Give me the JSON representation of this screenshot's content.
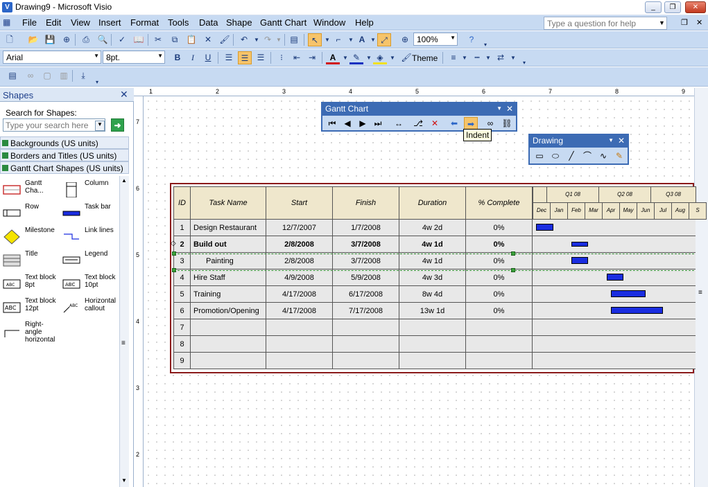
{
  "window": {
    "title": "Drawing9 - Microsoft Visio",
    "app_icon": "visio-icon",
    "min_label": "_",
    "max_label": "❐",
    "close_label": "✕"
  },
  "menu": {
    "items": [
      "File",
      "Edit",
      "View",
      "Insert",
      "Format",
      "Tools",
      "Data",
      "Shape",
      "Gantt Chart",
      "Window",
      "Help"
    ],
    "help_placeholder": "Type a question for help"
  },
  "standard_toolbar": {
    "zoom": "100%"
  },
  "format_toolbar": {
    "font": "Arial",
    "size": "8pt.",
    "bold": "B",
    "italic": "I",
    "underline": "U",
    "theme_label": "Theme"
  },
  "shapes_panel": {
    "title": "Shapes",
    "close": "✕",
    "search_label": "Search for Shapes:",
    "search_placeholder": "Type your search here",
    "stencils": [
      "Backgrounds (US units)",
      "Borders and Titles (US units)",
      "Gantt Chart Shapes (US units)"
    ],
    "items": [
      {
        "label": "Gantt Cha...",
        "icon": "gantt-chart-shape-icon"
      },
      {
        "label": "Column",
        "icon": "column-shape-icon"
      },
      {
        "label": "Row",
        "icon": "row-shape-icon"
      },
      {
        "label": "Task bar",
        "icon": "task-bar-shape-icon"
      },
      {
        "label": "Milestone",
        "icon": "milestone-shape-icon"
      },
      {
        "label": "Link lines",
        "icon": "link-lines-shape-icon"
      },
      {
        "label": "Title",
        "icon": "title-shape-icon"
      },
      {
        "label": "Legend",
        "icon": "legend-shape-icon"
      },
      {
        "label": "Text block 8pt",
        "icon": "text-block-8pt-icon"
      },
      {
        "label": "Text block 10pt",
        "icon": "text-block-10pt-icon"
      },
      {
        "label": "Text block 12pt",
        "icon": "text-block-12pt-icon"
      },
      {
        "label": "Horizontal callout",
        "icon": "horizontal-callout-icon"
      },
      {
        "label": "Right-angle horizontal",
        "icon": "right-angle-horizontal-icon"
      }
    ]
  },
  "ruler": {
    "top_numbers": [
      "1",
      "2",
      "3",
      "4",
      "5",
      "6",
      "7",
      "8",
      "9"
    ],
    "left_numbers": [
      "7",
      "6",
      "5",
      "4",
      "3",
      "2"
    ]
  },
  "gantt": {
    "headers": [
      "ID",
      "Task Name",
      "Start",
      "Finish",
      "Duration",
      "% Complete"
    ],
    "quarters": [
      "Q1 08",
      "Q2 08",
      "Q3 08"
    ],
    "months": [
      "Dec",
      "Jan",
      "Feb",
      "Mar",
      "Apr",
      "May",
      "Jun",
      "Jul",
      "Aug",
      "S"
    ],
    "rows": [
      {
        "id": "1",
        "name": "Design Restaurant",
        "start": "12/7/2007",
        "finish": "1/7/2008",
        "duration": "4w 2d",
        "pct": "0%"
      },
      {
        "id": "2",
        "name": "Build out",
        "start": "2/8/2008",
        "finish": "3/7/2008",
        "duration": "4w 1d",
        "pct": "0%"
      },
      {
        "id": "3",
        "name": "Painting",
        "start": "2/8/2008",
        "finish": "3/7/2008",
        "duration": "4w 1d",
        "pct": "0%"
      },
      {
        "id": "4",
        "name": "Hire Staff",
        "start": "4/9/2008",
        "finish": "5/9/2008",
        "duration": "4w 3d",
        "pct": "0%"
      },
      {
        "id": "5",
        "name": "Training",
        "start": "4/17/2008",
        "finish": "6/17/2008",
        "duration": "8w 4d",
        "pct": "0%"
      },
      {
        "id": "6",
        "name": "Promotion/Opening",
        "start": "4/17/2008",
        "finish": "7/17/2008",
        "duration": "13w 1d",
        "pct": "0%"
      },
      {
        "id": "7",
        "name": "",
        "start": "",
        "finish": "",
        "duration": "",
        "pct": ""
      },
      {
        "id": "8",
        "name": "",
        "start": "",
        "finish": "",
        "duration": "",
        "pct": ""
      },
      {
        "id": "9",
        "name": "",
        "start": "",
        "finish": "",
        "duration": "",
        "pct": ""
      }
    ]
  },
  "gantt_toolbar": {
    "title": "Gantt Chart",
    "tooltip": "Indent"
  },
  "drawing_toolbar": {
    "title": "Drawing"
  },
  "colors": {
    "chrome": "#c7daf2",
    "floating_title": "#3c6bb4",
    "task_bar": "#1a2de0",
    "gantt_border": "#8b1a1a",
    "header_fill": "#efe7cc"
  }
}
